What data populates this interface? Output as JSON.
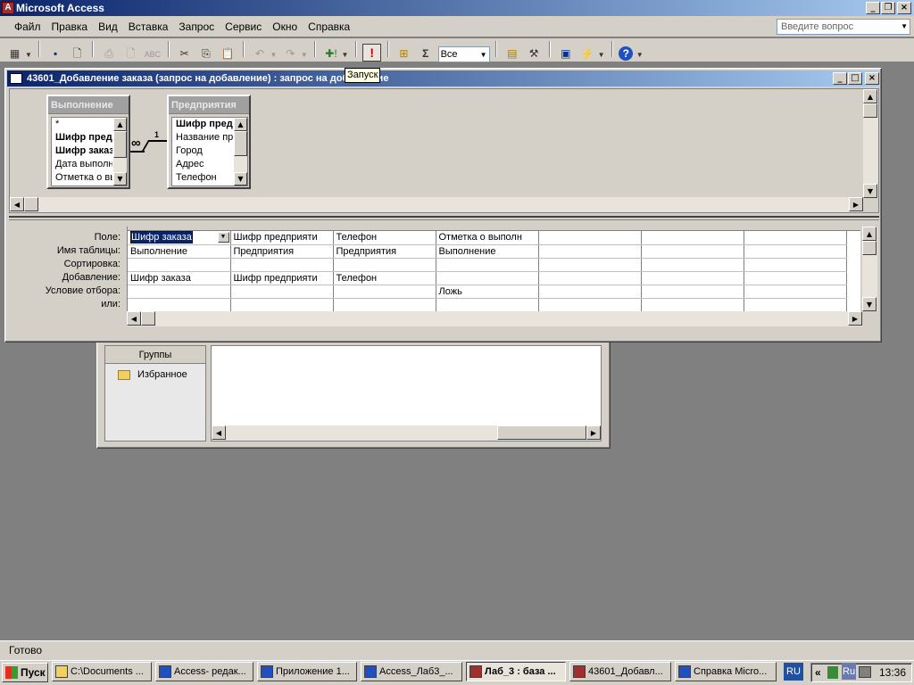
{
  "app": {
    "title": "Microsoft Access"
  },
  "menu": [
    "Файл",
    "Правка",
    "Вид",
    "Вставка",
    "Запрос",
    "Сервис",
    "Окно",
    "Справка"
  ],
  "help_box": {
    "placeholder": "Введите вопрос"
  },
  "toolbar": {
    "top_values": "Все",
    "tooltip": "Запуск",
    "sigma": "Σ"
  },
  "query_window": {
    "title": "43601_Добавление заказа (запрос на добавление) : запрос на добавление"
  },
  "tables": [
    {
      "name": "Выполнение",
      "fields": [
        "*",
        "Шифр предп",
        "Шифр заказа",
        "Дата выполн",
        "Отметка о вы"
      ],
      "bold": [
        1,
        2
      ]
    },
    {
      "name": "Предприятия",
      "fields": [
        "Шифр предп",
        "Название пре",
        "Город",
        "Адрес",
        "Телефон"
      ],
      "bold": [
        0
      ]
    }
  ],
  "relation": {
    "one": "1",
    "many": "∞"
  },
  "grid": {
    "row_labels": [
      "Поле:",
      "Имя таблицы:",
      "Сортировка:",
      "Добавление:",
      "Условие отбора:",
      "или:"
    ],
    "columns": [
      [
        "Шифр заказа",
        "Выполнение",
        "",
        "Шифр заказа",
        "",
        ""
      ],
      [
        "Шифр предприяти",
        "Предприятия",
        "",
        "Шифр предприяти",
        "",
        ""
      ],
      [
        "Телефон",
        "Предприятия",
        "",
        "Телефон",
        "",
        ""
      ],
      [
        "Отметка о выполн",
        "Выполнение",
        "",
        "",
        "Ложь",
        ""
      ],
      [
        "",
        "",
        "",
        "",
        "",
        ""
      ],
      [
        "",
        "",
        "",
        "",
        "",
        ""
      ],
      [
        "",
        "",
        "",
        "",
        "",
        ""
      ]
    ]
  },
  "db_window": {
    "groups_label": "Группы",
    "favorites": "Избранное"
  },
  "status": {
    "text": "Готово"
  },
  "taskbar": {
    "start": "Пуск",
    "items": [
      "C:\\Documents ...",
      "Access- редак...",
      "Приложение 1...",
      "Access_Лаб3_...",
      "Лаб_3 : база ...",
      "43601_Добавл...",
      "Справка Micro..."
    ],
    "lang": "RU",
    "tray_lang": "Ru",
    "clock": "13:36"
  }
}
